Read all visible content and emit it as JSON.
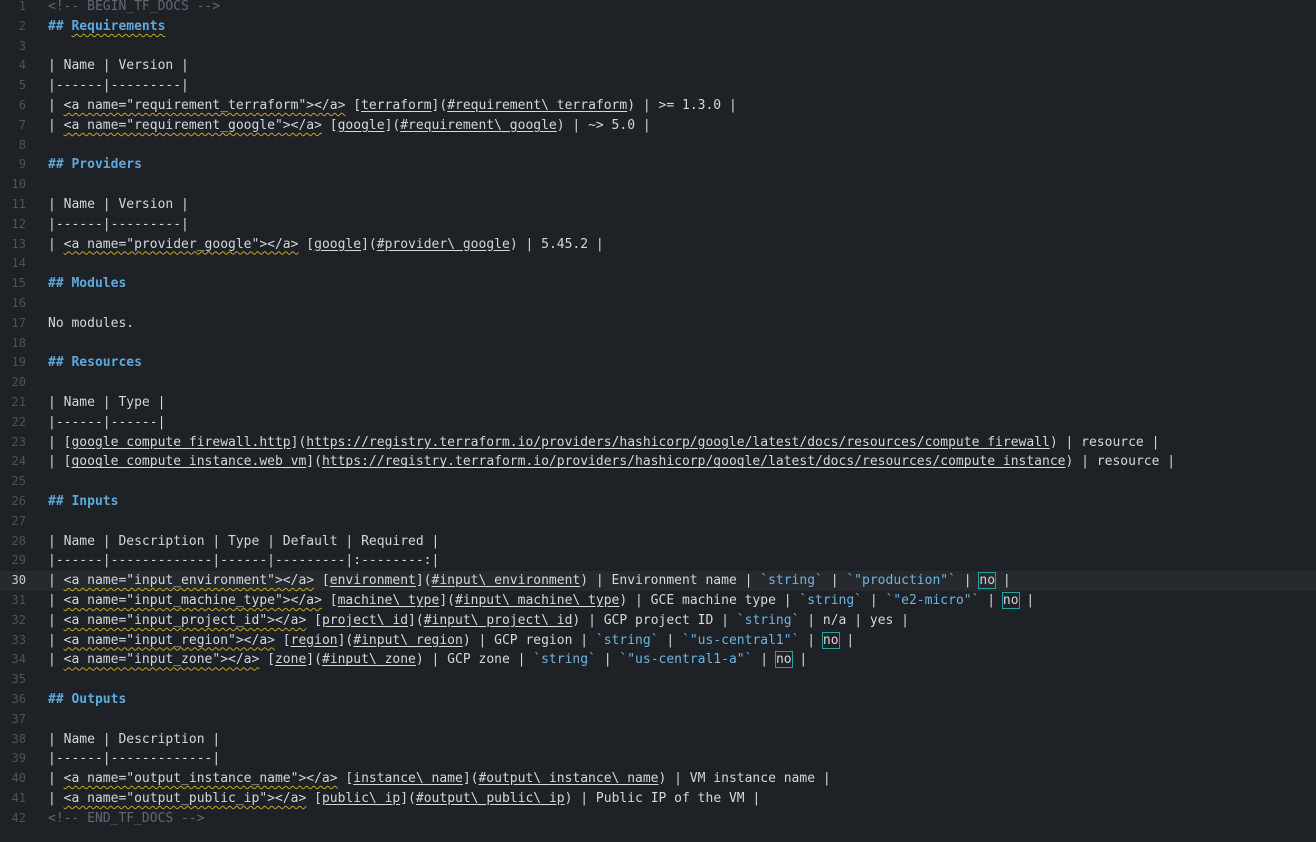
{
  "editor": {
    "current_line": 30,
    "lines": [
      {
        "n": "1",
        "kind": "comment",
        "parts": [
          {
            "t": "<!-- BEGIN_TF_DOCS -->"
          }
        ]
      },
      {
        "n": "2",
        "kind": "heading",
        "parts": [
          {
            "t": "## "
          },
          {
            "t": "Requirements",
            "s": "sq"
          }
        ]
      },
      {
        "n": "3",
        "kind": "text",
        "parts": []
      },
      {
        "n": "4",
        "kind": "text",
        "parts": [
          {
            "t": "| Name | Version |"
          }
        ]
      },
      {
        "n": "5",
        "kind": "text",
        "parts": [
          {
            "t": "|------|---------|"
          }
        ]
      },
      {
        "n": "6",
        "kind": "text",
        "parts": [
          {
            "t": "| "
          },
          {
            "t": "<a name=\"requirement_terraform\"></a>",
            "s": "sq"
          },
          {
            "t": " ["
          },
          {
            "t": "terraform",
            "s": "u"
          },
          {
            "t": "]("
          },
          {
            "t": "#requirement\\_terraform",
            "s": "u"
          },
          {
            "t": ") | >= 1.3.0 |"
          }
        ]
      },
      {
        "n": "7",
        "kind": "text",
        "parts": [
          {
            "t": "| "
          },
          {
            "t": "<a name=\"requirement_google\"></a>",
            "s": "sq"
          },
          {
            "t": " ["
          },
          {
            "t": "google",
            "s": "u"
          },
          {
            "t": "]("
          },
          {
            "t": "#requirement\\_google",
            "s": "u"
          },
          {
            "t": ") | ~> 5.0 |"
          }
        ]
      },
      {
        "n": "8",
        "kind": "text",
        "parts": []
      },
      {
        "n": "9",
        "kind": "heading",
        "parts": [
          {
            "t": "## Providers"
          }
        ]
      },
      {
        "n": "10",
        "kind": "text",
        "parts": []
      },
      {
        "n": "11",
        "kind": "text",
        "parts": [
          {
            "t": "| Name | Version |"
          }
        ]
      },
      {
        "n": "12",
        "kind": "text",
        "parts": [
          {
            "t": "|------|---------|"
          }
        ]
      },
      {
        "n": "13",
        "kind": "text",
        "parts": [
          {
            "t": "| "
          },
          {
            "t": "<a name=\"provider_google\"></a>",
            "s": "sq"
          },
          {
            "t": " ["
          },
          {
            "t": "google",
            "s": "u"
          },
          {
            "t": "]("
          },
          {
            "t": "#provider\\_google",
            "s": "u"
          },
          {
            "t": ") | 5.45.2 |"
          }
        ]
      },
      {
        "n": "14",
        "kind": "text",
        "parts": []
      },
      {
        "n": "15",
        "kind": "heading",
        "parts": [
          {
            "t": "## Modules"
          }
        ]
      },
      {
        "n": "16",
        "kind": "text",
        "parts": []
      },
      {
        "n": "17",
        "kind": "text",
        "parts": [
          {
            "t": "No modules."
          }
        ]
      },
      {
        "n": "18",
        "kind": "text",
        "parts": []
      },
      {
        "n": "19",
        "kind": "heading",
        "parts": [
          {
            "t": "## Resources"
          }
        ]
      },
      {
        "n": "20",
        "kind": "text",
        "parts": []
      },
      {
        "n": "21",
        "kind": "text",
        "parts": [
          {
            "t": "| Name | Type |"
          }
        ]
      },
      {
        "n": "22",
        "kind": "text",
        "parts": [
          {
            "t": "|------|------|"
          }
        ]
      },
      {
        "n": "23",
        "kind": "text",
        "parts": [
          {
            "t": "| ["
          },
          {
            "t": "google_compute_firewall.http",
            "s": "u"
          },
          {
            "t": "]("
          },
          {
            "t": "https://registry.terraform.io/providers/hashicorp/google/latest/docs/resources/compute_firewall",
            "s": "u"
          },
          {
            "t": ") | resource |"
          }
        ]
      },
      {
        "n": "24",
        "kind": "text",
        "parts": [
          {
            "t": "| ["
          },
          {
            "t": "google_compute_instance.web_vm",
            "s": "u"
          },
          {
            "t": "]("
          },
          {
            "t": "https://registry.terraform.io/providers/hashicorp/google/latest/docs/resources/compute_instance",
            "s": "u"
          },
          {
            "t": ") | resource |"
          }
        ]
      },
      {
        "n": "25",
        "kind": "text",
        "parts": []
      },
      {
        "n": "26",
        "kind": "heading",
        "parts": [
          {
            "t": "## Inputs"
          }
        ]
      },
      {
        "n": "27",
        "kind": "text",
        "parts": []
      },
      {
        "n": "28",
        "kind": "text",
        "parts": [
          {
            "t": "| Name | Description | Type | Default | Required |"
          }
        ]
      },
      {
        "n": "29",
        "kind": "text",
        "parts": [
          {
            "t": "|------|-------------|------|---------|:--------:|"
          }
        ]
      },
      {
        "n": "30",
        "kind": "text",
        "parts": [
          {
            "t": "| "
          },
          {
            "t": "<a name=\"input_environment\"></a>",
            "s": "sq"
          },
          {
            "t": " ["
          },
          {
            "t": "environment",
            "s": "u"
          },
          {
            "t": "]("
          },
          {
            "t": "#input\\_environment",
            "s": "u"
          },
          {
            "t": ") | Environment name | "
          },
          {
            "t": "`string`",
            "s": "code"
          },
          {
            "t": " | "
          },
          {
            "t": "`\"production\"`",
            "s": "code"
          },
          {
            "t": " | "
          },
          {
            "t": "no",
            "s": "box"
          },
          {
            "t": " |"
          }
        ]
      },
      {
        "n": "31",
        "kind": "text",
        "parts": [
          {
            "t": "| "
          },
          {
            "t": "<a name=\"input_machine_type\"></a>",
            "s": "sq"
          },
          {
            "t": " ["
          },
          {
            "t": "machine\\_type",
            "s": "u"
          },
          {
            "t": "]("
          },
          {
            "t": "#input\\_machine\\_type",
            "s": "u"
          },
          {
            "t": ") | GCE machine type | "
          },
          {
            "t": "`string`",
            "s": "code"
          },
          {
            "t": " | "
          },
          {
            "t": "`\"e2-micro\"`",
            "s": "code"
          },
          {
            "t": " | "
          },
          {
            "t": "no",
            "s": "box"
          },
          {
            "t": " |"
          }
        ]
      },
      {
        "n": "32",
        "kind": "text",
        "parts": [
          {
            "t": "| "
          },
          {
            "t": "<a name=\"input_project_id\"></a>",
            "s": "sq"
          },
          {
            "t": " ["
          },
          {
            "t": "project\\_id",
            "s": "u"
          },
          {
            "t": "]("
          },
          {
            "t": "#input\\_project\\_id",
            "s": "u"
          },
          {
            "t": ") | GCP project ID | "
          },
          {
            "t": "`string`",
            "s": "code"
          },
          {
            "t": " | n/a | yes |"
          }
        ]
      },
      {
        "n": "33",
        "kind": "text",
        "parts": [
          {
            "t": "| "
          },
          {
            "t": "<a name=\"input_region\"></a>",
            "s": "sq"
          },
          {
            "t": " ["
          },
          {
            "t": "region",
            "s": "u"
          },
          {
            "t": "]("
          },
          {
            "t": "#input\\_region",
            "s": "u"
          },
          {
            "t": ") | GCP region | "
          },
          {
            "t": "`string`",
            "s": "code"
          },
          {
            "t": " | "
          },
          {
            "t": "`\"us-central1\"`",
            "s": "code"
          },
          {
            "t": " | "
          },
          {
            "t": "no",
            "s": "box"
          },
          {
            "t": " |"
          }
        ]
      },
      {
        "n": "34",
        "kind": "text",
        "parts": [
          {
            "t": "| "
          },
          {
            "t": "<a name=\"input_zone\"></a>",
            "s": "sq"
          },
          {
            "t": " ["
          },
          {
            "t": "zone",
            "s": "u"
          },
          {
            "t": "]("
          },
          {
            "t": "#input\\_zone",
            "s": "u"
          },
          {
            "t": ") | GCP zone | "
          },
          {
            "t": "`string`",
            "s": "code"
          },
          {
            "t": " | "
          },
          {
            "t": "`\"us-central1-a\"`",
            "s": "code"
          },
          {
            "t": " | "
          },
          {
            "t": "no",
            "s": "box"
          },
          {
            "t": " |"
          }
        ]
      },
      {
        "n": "35",
        "kind": "text",
        "parts": []
      },
      {
        "n": "36",
        "kind": "heading",
        "parts": [
          {
            "t": "## Outputs"
          }
        ]
      },
      {
        "n": "37",
        "kind": "text",
        "parts": []
      },
      {
        "n": "38",
        "kind": "text",
        "parts": [
          {
            "t": "| Name | Description |"
          }
        ]
      },
      {
        "n": "39",
        "kind": "text",
        "parts": [
          {
            "t": "|------|-------------|"
          }
        ]
      },
      {
        "n": "40",
        "kind": "text",
        "parts": [
          {
            "t": "| "
          },
          {
            "t": "<a name=\"output_instance_name\"></a>",
            "s": "sq"
          },
          {
            "t": " ["
          },
          {
            "t": "instance\\_name",
            "s": "u"
          },
          {
            "t": "]("
          },
          {
            "t": "#output\\_instance\\_name",
            "s": "u"
          },
          {
            "t": ") | VM instance name |"
          }
        ]
      },
      {
        "n": "41",
        "kind": "text",
        "parts": [
          {
            "t": "| "
          },
          {
            "t": "<a name=\"output_public_ip\"></a>",
            "s": "sq"
          },
          {
            "t": " ["
          },
          {
            "t": "public\\_ip",
            "s": "u"
          },
          {
            "t": "]("
          },
          {
            "t": "#output\\_public\\_ip",
            "s": "u"
          },
          {
            "t": ") | Public IP of the VM |"
          }
        ]
      },
      {
        "n": "42",
        "kind": "comment",
        "parts": [
          {
            "t": "<!-- END_TF_DOCS -->"
          }
        ]
      }
    ]
  }
}
